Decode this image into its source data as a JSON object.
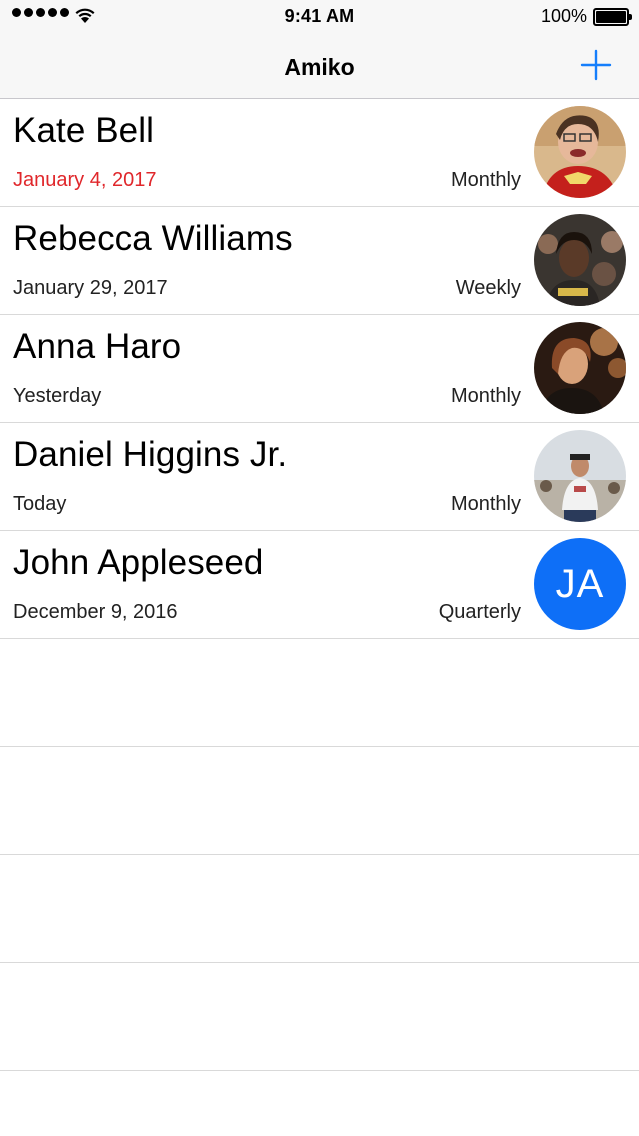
{
  "status": {
    "time": "9:41 AM",
    "battery": "100%"
  },
  "nav": {
    "title": "Amiko",
    "add_icon": "plus-icon"
  },
  "colors": {
    "accent": "#157efb",
    "overdue": "#e0272b",
    "initials_bg": "#0e6ff7"
  },
  "contacts": [
    {
      "name": "Kate Bell",
      "date": "January 4, 2017",
      "frequency": "Monthly",
      "overdue": true,
      "avatar": "photo"
    },
    {
      "name": "Rebecca Williams",
      "date": "January 29, 2017",
      "frequency": "Weekly",
      "overdue": false,
      "avatar": "photo"
    },
    {
      "name": "Anna Haro",
      "date": "Yesterday",
      "frequency": "Monthly",
      "overdue": false,
      "avatar": "photo"
    },
    {
      "name": "Daniel Higgins Jr.",
      "date": "Today",
      "frequency": "Monthly",
      "overdue": false,
      "avatar": "photo"
    },
    {
      "name": "John Appleseed",
      "date": "December 9, 2016",
      "frequency": "Quarterly",
      "overdue": false,
      "avatar": "initials",
      "initials": "JA"
    }
  ]
}
